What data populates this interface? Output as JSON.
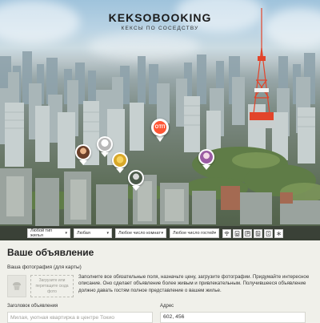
{
  "header": {
    "logo": "KEKSOBOOKING",
    "tagline": "КЕКСЫ ПО СОСЕДСТВУ"
  },
  "map": {
    "pins": [
      {
        "name": "user-avatar-pin-1",
        "color": "#8a5a40"
      },
      {
        "name": "user-avatar-pin-2",
        "color": "#c9c9c9"
      },
      {
        "name": "user-avatar-pin-3",
        "color": "#f1c232"
      },
      {
        "name": "user-avatar-pin-4",
        "color": "#5e6b5a"
      },
      {
        "name": "user-avatar-pin-5",
        "color": "#b07ab5"
      }
    ],
    "main_pin_label": "ОТП"
  },
  "filters": {
    "housing_type": "Любой тип жилья",
    "price": "Любая",
    "rooms": "Любое число комнат",
    "guests": "Любое число гостей",
    "features": [
      "wifi-icon",
      "dishwasher-icon",
      "parking-icon",
      "washer-icon",
      "elevator-icon",
      "conditioner-icon"
    ]
  },
  "form": {
    "title": "Ваше объявление",
    "photo_label": "Ваша фотография (для карты)",
    "drop_zone": "Загрузите или перетащите сюда фото",
    "notice": "Заполните все обязательные поля, назначьте цену, загрузите фотографии. Придумайте интересное описание. Оно сделает объявление более живым и привлекательным. Получившееся объявление должно давать гостям полное представление о вашем жилье.",
    "title_label": "Заголовок объявления",
    "title_placeholder": "Милая, уютная квартирка в центре Токио",
    "address_label": "Адрес",
    "address_value": "602, 456"
  },
  "colors": {
    "accent": "#ff5635",
    "form_bg": "#f0f0ea",
    "filters_bg": "#2c2c2c"
  }
}
